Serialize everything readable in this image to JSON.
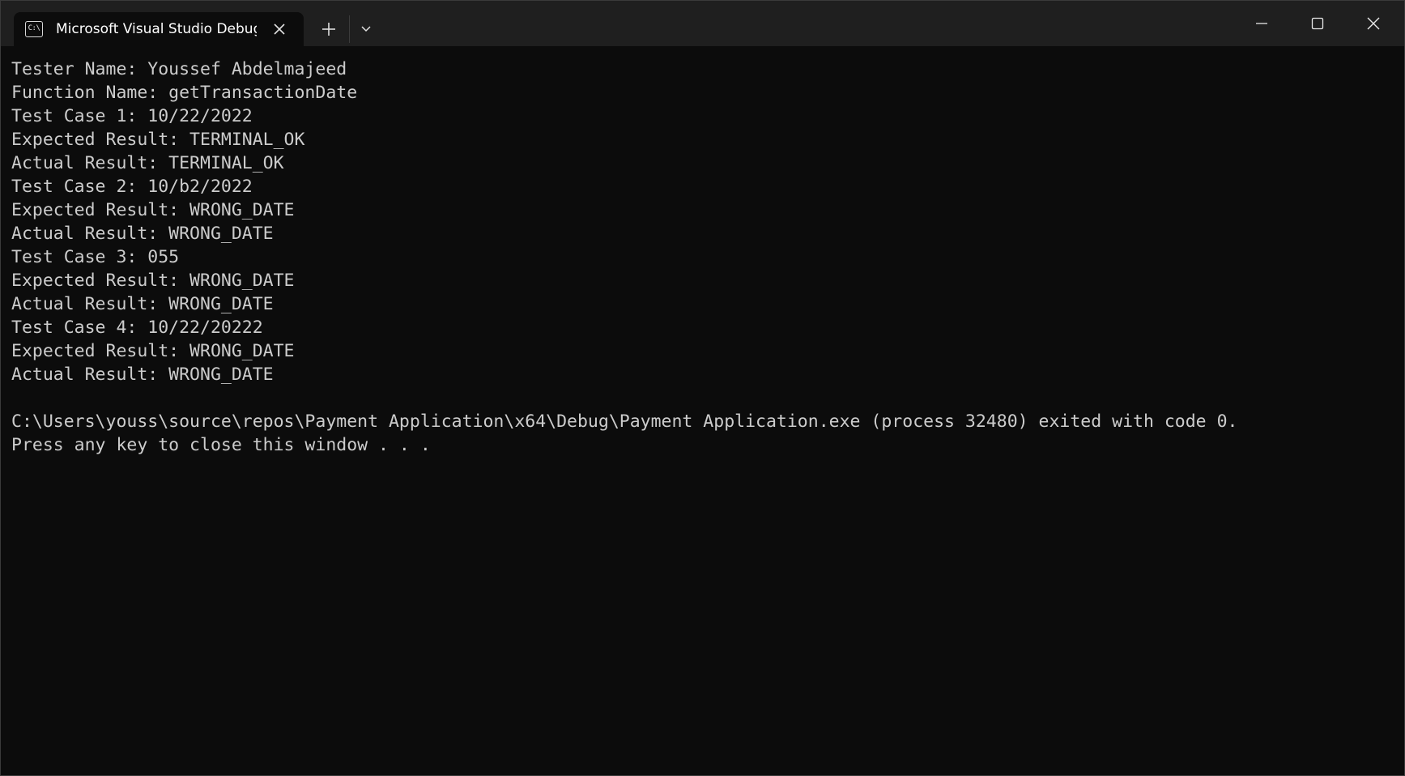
{
  "tab": {
    "icon_text": "C:\\",
    "title": "Microsoft Visual Studio Debug Console"
  },
  "icons": {
    "tab_icon": "console-icon",
    "tab_close": "close-icon",
    "new_tab": "plus-icon",
    "dropdown": "chevron-down-icon",
    "minimize": "minimize-icon",
    "maximize": "maximize-icon",
    "close": "close-icon"
  },
  "colors": {
    "background": "#0c0c0c",
    "titlebar": "#1f1f1f",
    "text": "#cccccc"
  },
  "console": {
    "lines": [
      "Tester Name: Youssef Abdelmajeed",
      "Function Name: getTransactionDate",
      "Test Case 1: 10/22/2022",
      "Expected Result: TERMINAL_OK",
      "Actual Result: TERMINAL_OK",
      "Test Case 2: 10/b2/2022",
      "Expected Result: WRONG_DATE",
      "Actual Result: WRONG_DATE",
      "Test Case 3: 055",
      "Expected Result: WRONG_DATE",
      "Actual Result: WRONG_DATE",
      "Test Case 4: 10/22/20222",
      "Expected Result: WRONG_DATE",
      "Actual Result: WRONG_DATE",
      "",
      "C:\\Users\\youss\\source\\repos\\Payment Application\\x64\\Debug\\Payment Application.exe (process 32480) exited with code 0.",
      "Press any key to close this window . . ."
    ]
  }
}
